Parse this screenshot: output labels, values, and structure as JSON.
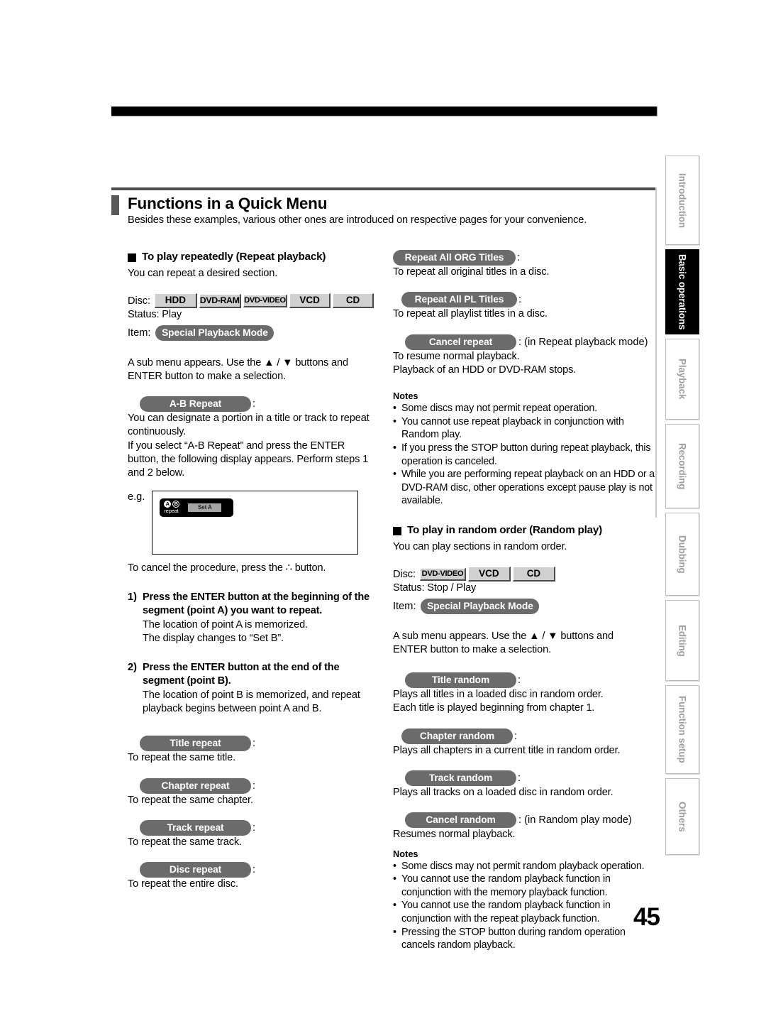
{
  "page": {
    "number": "45",
    "section_title": "Functions in a Quick Menu",
    "section_subtitle": "Besides these examples, various other ones are introduced on respective pages for your convenience."
  },
  "side_tabs": [
    {
      "label": "Introduction",
      "active": false
    },
    {
      "label": "Basic operations",
      "active": true
    },
    {
      "label": "Playback",
      "active": false
    },
    {
      "label": "Recording",
      "active": false
    },
    {
      "label": "Dubbing",
      "active": false
    },
    {
      "label": "Editing",
      "active": false
    },
    {
      "label": "Function setup",
      "active": false
    },
    {
      "label": "Others",
      "active": false
    }
  ],
  "left_column": {
    "heading": "To play repeatedly (Repeat playback)",
    "intro": "You can repeat a desired section.",
    "disc_label": "Disc:",
    "disc_badges": [
      "HDD",
      "DVD-RAM",
      "DVD-VIDEO",
      "VCD",
      "CD"
    ],
    "status": "Status: Play",
    "item_label": "Item:",
    "item_value": "Special Playback Mode",
    "submenu_line1": "A sub menu appears. Use the ▲ / ▼ buttons and",
    "submenu_line2": "ENTER button to make a selection.",
    "ab_repeat": {
      "badge": "A-B Repeat",
      "colon": ":",
      "line1": "You can designate a portion in a title or track to repeat",
      "line2": "continuously.",
      "line3": "If you select “A-B Repeat” and press the ENTER",
      "line4": "button, the following display appears. Perform steps 1",
      "line5": "and 2 below."
    },
    "example": {
      "label": "e.g.",
      "osd_a": "A",
      "osd_b": "B",
      "osd_repeat": "repeat",
      "osd_button": "Set A"
    },
    "cancel_line": "To cancel the procedure, press the ∴ button.",
    "steps": [
      {
        "num": "1)",
        "head_line1": "Press the ENTER button at the beginning of the",
        "head_line2": "segment (point A) you want to repeat.",
        "body_line1": "The location of point A is memorized.",
        "body_line2": "The display changes to “Set B”."
      },
      {
        "num": "2)",
        "head_line1": "Press the ENTER button at the end of the",
        "head_line2": "segment (point B).",
        "body_line1": "The location of point B is memorized, and repeat",
        "body_line2": "playback begins between point A and B."
      }
    ],
    "modes": [
      {
        "badge": "Title repeat",
        "desc": "To repeat the same title."
      },
      {
        "badge": "Chapter repeat",
        "desc": "To repeat the same chapter."
      },
      {
        "badge": "Track repeat",
        "desc": "To repeat the same track."
      },
      {
        "badge": "Disc repeat",
        "desc": "To repeat the entire disc."
      }
    ]
  },
  "right_column": {
    "repeat_modes": [
      {
        "badge": "Repeat All ORG Titles",
        "suffix": ":",
        "desc": "To repeat all original titles in a disc."
      },
      {
        "badge": "Repeat All PL Titles",
        "suffix": ":",
        "desc": "To repeat all playlist titles in a disc."
      }
    ],
    "cancel_repeat": {
      "badge": "Cancel repeat",
      "suffix": ": (in Repeat playback mode)",
      "line1": "To resume normal playback.",
      "line2": "Playback of an HDD or DVD-RAM stops."
    },
    "notes1_title": "Notes",
    "notes1": [
      [
        "Some discs may not permit repeat operation."
      ],
      [
        "You cannot use repeat playback in conjunction with",
        "Random play."
      ],
      [
        "If you press the STOP button during repeat playback, this",
        "operation is canceled."
      ],
      [
        "While you are performing repeat playback on an HDD or a",
        "DVD-RAM disc, other operations except pause play is not",
        "available."
      ]
    ],
    "random_heading": "To play in random order (Random play)",
    "random_intro": "You can play sections in random order.",
    "disc_label": "Disc:",
    "disc_badges": [
      "DVD-VIDEO",
      "VCD",
      "CD"
    ],
    "status": "Status: Stop / Play",
    "item_label": "Item:",
    "item_value": "Special Playback Mode",
    "submenu_line1": "A sub menu appears. Use the ▲ / ▼ buttons and",
    "submenu_line2": "ENTER button to make a selection.",
    "random_modes": [
      {
        "badge": "Title random",
        "suffix": ":",
        "line1": "Plays all titles in a loaded disc in random order.",
        "line2": "Each title is played beginning from chapter 1."
      },
      {
        "badge": "Chapter random",
        "suffix": ":",
        "line1": "Plays all chapters in a current title in random order.",
        "line2": ""
      },
      {
        "badge": "Track random",
        "suffix": ":",
        "line1": "Plays all tracks on a loaded disc in random order.",
        "line2": ""
      },
      {
        "badge": "Cancel random",
        "suffix": ": (in Random play mode)",
        "line1": "Resumes normal playback.",
        "line2": ""
      }
    ],
    "notes2_title": "Notes",
    "notes2": [
      [
        "Some discs may not permit random playback operation."
      ],
      [
        "You cannot use the random playback function in",
        "conjunction with the memory playback function."
      ],
      [
        "You cannot use the random playback function in",
        "conjunction with the repeat playback function."
      ],
      [
        "Pressing the STOP button during random operation",
        "cancels random playback."
      ]
    ]
  },
  "colors": {
    "pill": "#6b6b6b",
    "disc_badge": "#d0d0d0",
    "rule": "#4e4e4e",
    "tab_inactive_text": "#9d9d9d"
  }
}
